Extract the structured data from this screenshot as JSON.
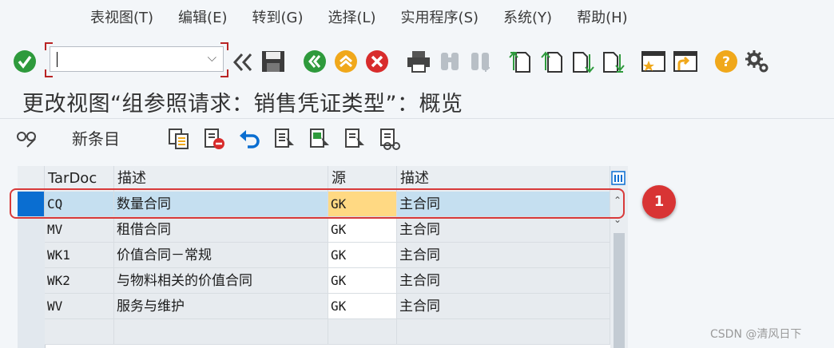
{
  "menu": {
    "items": [
      "表视图(T)",
      "编辑(E)",
      "转到(G)",
      "选择(L)",
      "实用程序(S)",
      "系统(Y)",
      "帮助(H)"
    ]
  },
  "toolbar": {
    "command_value": "",
    "icons": [
      "check-icon",
      "back-nav-icon",
      "save-icon",
      "back-icon",
      "exit-icon",
      "cancel-icon",
      "print-icon",
      "find-icon",
      "find-next-icon",
      "first-page-icon",
      "prev-page-icon",
      "next-page-icon",
      "last-page-icon",
      "new-session-icon",
      "shortcut-icon",
      "help-icon",
      "settings-icon"
    ]
  },
  "title": "更改视图“组参照请求：销售凭证类型”：概览",
  "app_toolbar": {
    "new_entries": "新条目"
  },
  "table": {
    "columns": [
      "TarDoc",
      "描述",
      "源",
      "描述"
    ],
    "rows": [
      {
        "tardoc": "CQ",
        "desc": "数量合同",
        "src": "GK",
        "src_desc": "主合同",
        "selected": true
      },
      {
        "tardoc": "MV",
        "desc": "租借合同",
        "src": "GK",
        "src_desc": "主合同"
      },
      {
        "tardoc": "WK1",
        "desc": "价值合同－常规",
        "src": "GK",
        "src_desc": "主合同"
      },
      {
        "tardoc": "WK2",
        "desc": "与物料相关的价值合同",
        "src": "GK",
        "src_desc": "主合同"
      },
      {
        "tardoc": "WV",
        "desc": "服务与维护",
        "src": "GK",
        "src_desc": "主合同"
      }
    ]
  },
  "annotation": {
    "badge": "1"
  },
  "watermark": "CSDN @清风日下",
  "colors": {
    "selected_row": "#c5dff0",
    "selected_cell": "#ffd983",
    "row_marker": "#0070c0",
    "badge": "#d83434"
  }
}
